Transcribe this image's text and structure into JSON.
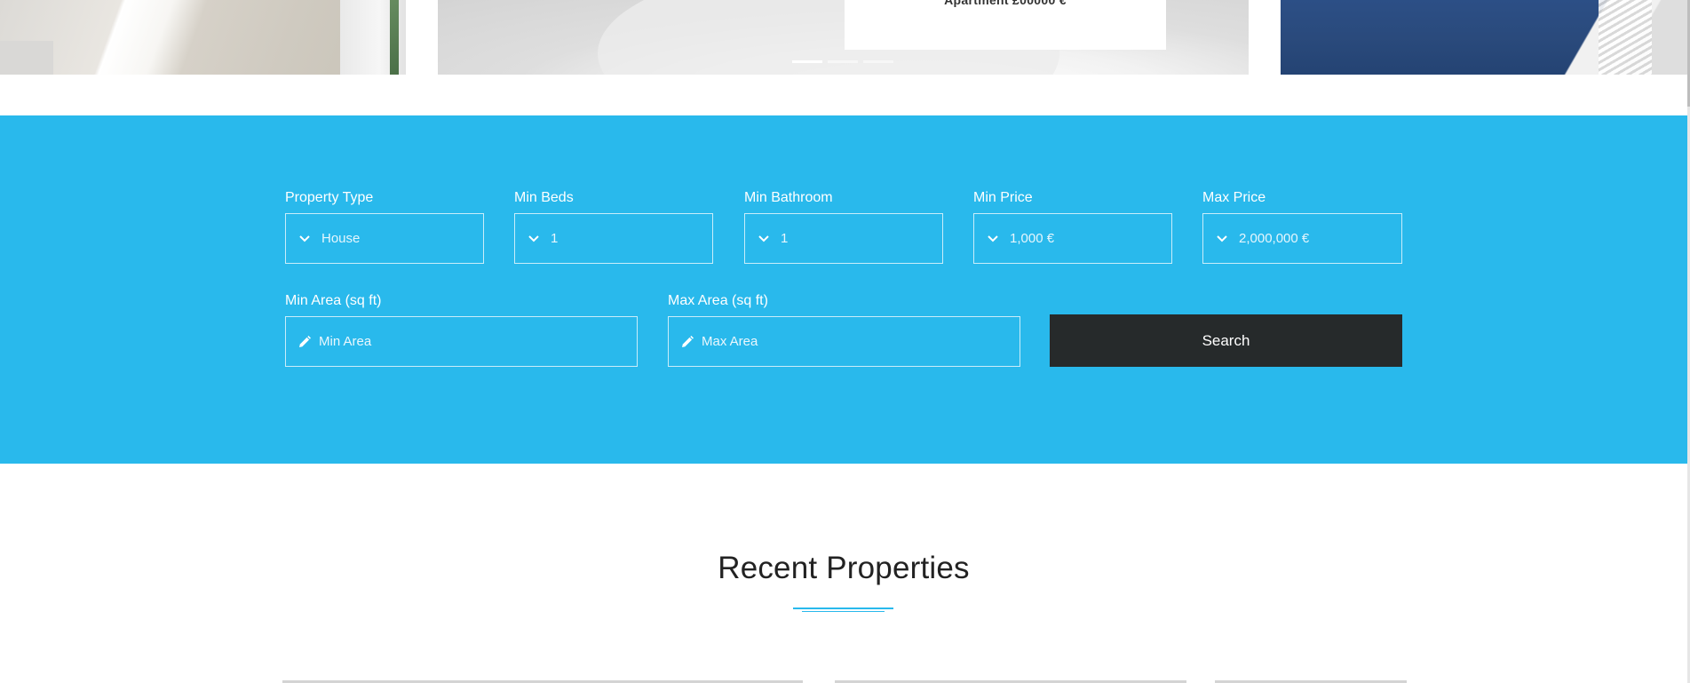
{
  "hero": {
    "caption": "Apartment  £00000 €",
    "dots": 3,
    "active_dot": 0
  },
  "search": {
    "fields": [
      {
        "label": "Property Type",
        "value": "House",
        "icon": "chevron-down-icon"
      },
      {
        "label": "Min Beds",
        "value": "1",
        "icon": "chevron-down-icon"
      },
      {
        "label": "Min Bathroom",
        "value": "1",
        "icon": "chevron-down-icon"
      },
      {
        "label": "Min Price",
        "value": "1,000 €",
        "icon": "chevron-down-icon"
      },
      {
        "label": "Max Price",
        "value": "2,000,000 €",
        "icon": "chevron-down-icon"
      }
    ],
    "min_area": {
      "label": "Min Area (sq ft)",
      "placeholder": "Min Area",
      "icon": "pencil-icon"
    },
    "max_area": {
      "label": "Max Area (sq ft)",
      "placeholder": "Max Area",
      "icon": "pencil-icon"
    },
    "button_label": "Search"
  },
  "recent": {
    "title": "Recent Properties"
  },
  "colors": {
    "accent": "#29b9ec",
    "button": "#262a2b"
  }
}
